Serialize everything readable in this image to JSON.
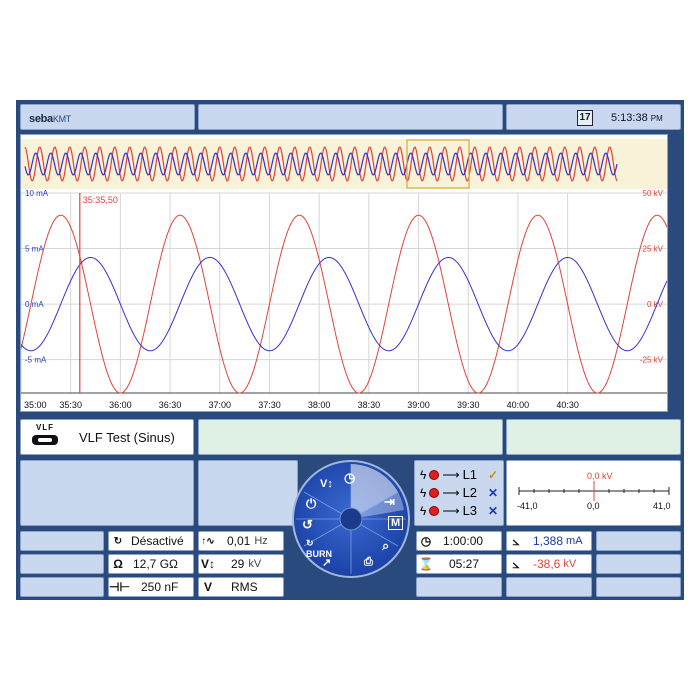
{
  "header": {
    "logo_main": "seba",
    "logo_sub": "KMT",
    "calendar_day": "17",
    "time": "5:13:38",
    "ampm": "PM"
  },
  "chart_data": {
    "type": "line",
    "x_ticks": [
      "35:00",
      "35:30",
      "36:00",
      "36:30",
      "37:00",
      "37:30",
      "38:00",
      "38:30",
      "39:00",
      "39:30",
      "40:00",
      "40:30"
    ],
    "left_axis": {
      "ticks": [
        "10 mA",
        "5 mA",
        "0 mA",
        "-5 mA"
      ],
      "range": [
        -8,
        10
      ],
      "unit": "mA"
    },
    "right_axis": {
      "ticks": [
        "50 kV",
        "25 kV",
        "0 kV",
        "-25 kV"
      ],
      "range": [
        -40,
        50
      ],
      "unit": "kV"
    },
    "cursor_label": "35:35,50",
    "series": [
      {
        "color": "#e0443a",
        "amplitude": 40,
        "period_s": 72,
        "phase_s": 1890,
        "axis": "right"
      },
      {
        "color": "#3333cc",
        "amplitude": 4.2,
        "period_s": 72,
        "phase_s": 1908,
        "axis": "left"
      }
    ],
    "grid": true
  },
  "mode": {
    "icon_text": "VLF",
    "title": "VLF Test (Sinus)"
  },
  "params": {
    "burn_label": "BURN",
    "burn_value": "Désactivé",
    "resistance_symbol": "Ω",
    "resistance_value": "12,7 GΩ",
    "capacitance_value": "250 nF",
    "freq_value": "0,01",
    "freq_unit": "Hz",
    "voltage_value": "29",
    "voltage_unit": "kV",
    "v_label": "V",
    "rms_label": "RMS",
    "duration": "1:00:00",
    "elapsed": "05:27",
    "current_value": "1,388",
    "current_unit": "mA",
    "volt_meas_value": "-38,6",
    "volt_meas_unit": "kV"
  },
  "phases": [
    {
      "label": "L1",
      "status": "✓",
      "status_color": "#d08a10"
    },
    {
      "label": "L2",
      "status": "✕",
      "status_color": "#1a3aa8"
    },
    {
      "label": "L3",
      "status": "✕",
      "status_color": "#1a3aa8"
    }
  ],
  "gauge": {
    "value_label": "0,0 kV",
    "min": "-41,0",
    "mid": "0,0",
    "max": "41,0"
  },
  "dial": {
    "accent": "#1d44a8"
  }
}
